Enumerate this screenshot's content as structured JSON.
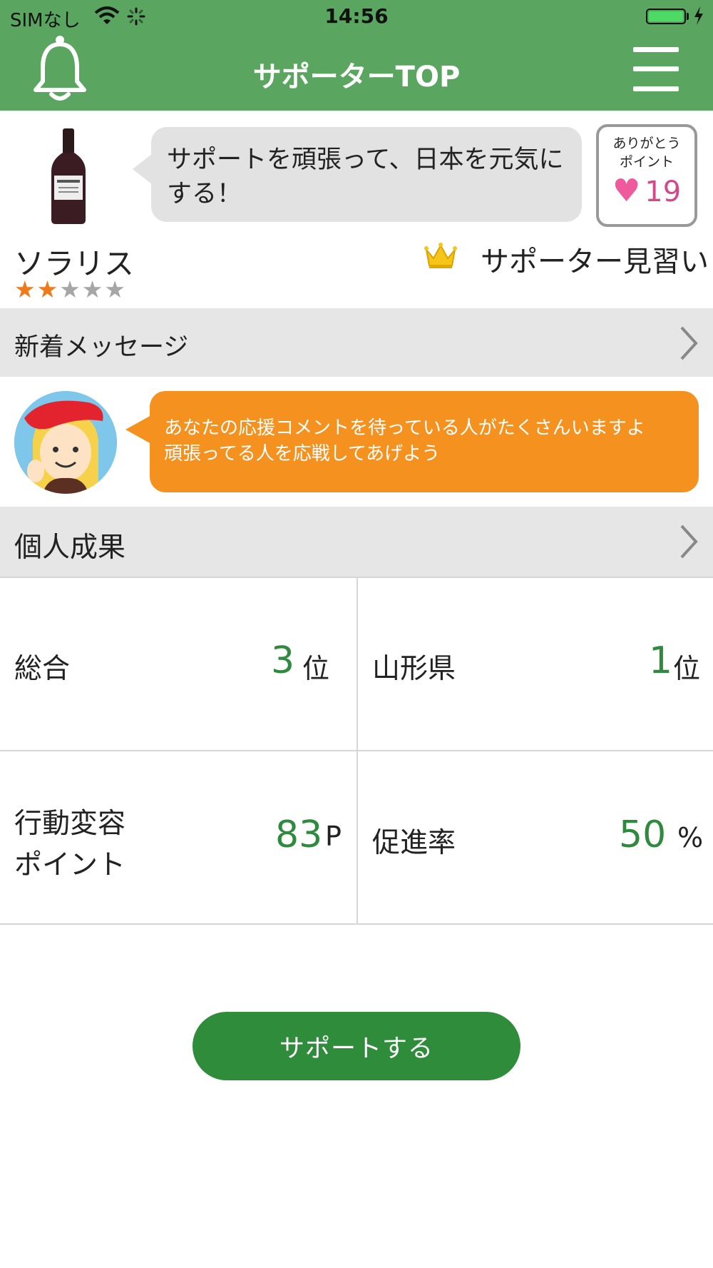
{
  "status_bar": {
    "carrier": "SIMなし",
    "time": "14:56"
  },
  "nav": {
    "title": "サポーターTOP"
  },
  "profile": {
    "speech": "サポートを頑張って、日本を元気にする！",
    "thanks_label": "ありがとう\nポイント",
    "thanks_points": "19",
    "name": "ソラリス",
    "stars_filled": 2,
    "stars_total": 5,
    "rank_title": "サポーター見習い"
  },
  "messages": {
    "header": "新着メッセージ",
    "line1": "あなたの応援コメントを待っている人がたくさんいますよ",
    "line2": "頑張ってる人を応戦してあげよう"
  },
  "results": {
    "header": "個人成果",
    "overall": {
      "label": "総合",
      "value": "3",
      "unit": "位"
    },
    "prefecture": {
      "label": "山形県",
      "value": "1",
      "unit": "位"
    },
    "behavior": {
      "label_line1": "行動変容",
      "label_line2": "ポイント",
      "value": "83",
      "unit": "P"
    },
    "promotion": {
      "label": "促進率",
      "value": "50",
      "unit": "%"
    }
  },
  "actions": {
    "support_button": "サポートする"
  },
  "colors": {
    "nav_green": "#5aa660",
    "button_green": "#2f8c3a",
    "value_green": "#2e8a3c",
    "orange": "#f5921f",
    "heart_pink": "#ef5a9d"
  }
}
